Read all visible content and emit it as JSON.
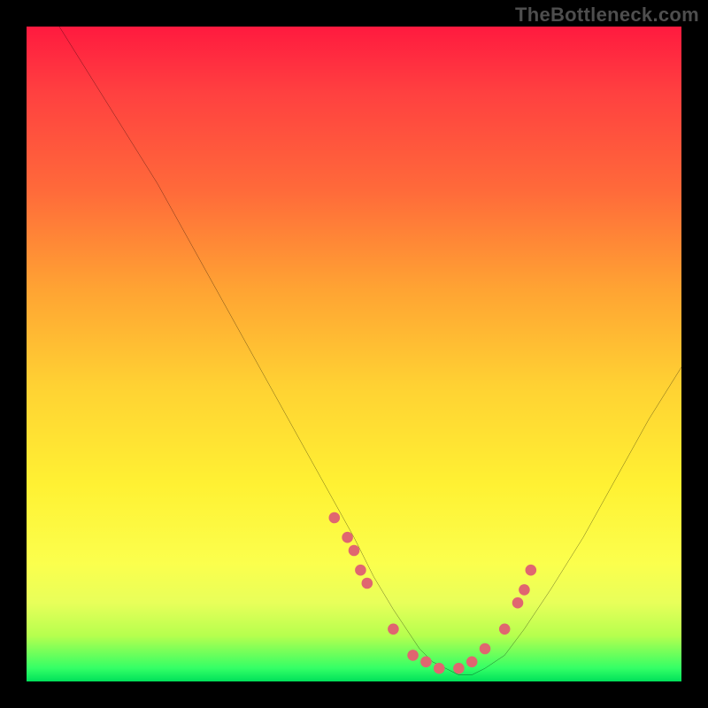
{
  "watermark": "TheBottleneck.com",
  "chart_data": {
    "type": "line",
    "title": "",
    "xlabel": "",
    "ylabel": "",
    "xlim": [
      0,
      100
    ],
    "ylim": [
      0,
      100
    ],
    "series": [
      {
        "name": "curve",
        "x": [
          5,
          10,
          15,
          20,
          25,
          30,
          35,
          40,
          45,
          50,
          53,
          56,
          58,
          60,
          62,
          64,
          66,
          68,
          70,
          73,
          76,
          80,
          85,
          90,
          95,
          100
        ],
        "values": [
          100,
          92,
          84,
          76,
          67,
          58,
          49,
          40,
          31,
          22,
          16,
          11,
          8,
          5,
          3,
          2,
          1,
          1,
          2,
          4,
          8,
          14,
          22,
          31,
          40,
          48
        ]
      }
    ],
    "markers": {
      "name": "dots",
      "color": "#e06670",
      "x": [
        47,
        49,
        50,
        51,
        52,
        56,
        59,
        61,
        63,
        66,
        68,
        70,
        73,
        75,
        76,
        77
      ],
      "values": [
        25,
        22,
        20,
        17,
        15,
        8,
        4,
        3,
        2,
        2,
        3,
        5,
        8,
        12,
        14,
        17
      ]
    }
  }
}
